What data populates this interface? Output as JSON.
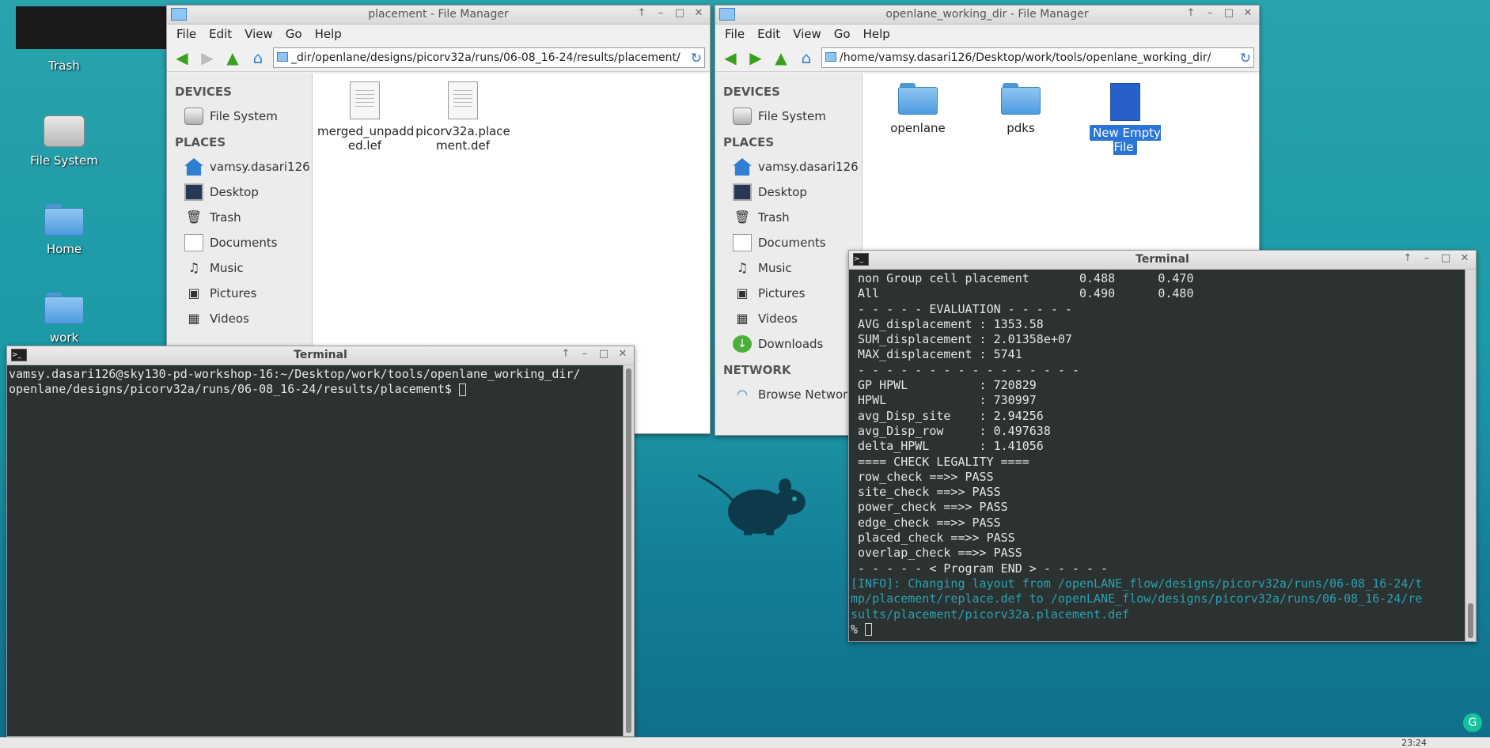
{
  "desktop": {
    "icons": [
      {
        "label": "Trash"
      },
      {
        "label": "File System"
      },
      {
        "label": "Home"
      },
      {
        "label": "work"
      }
    ]
  },
  "fm1": {
    "title": "placement - File Manager",
    "menu": [
      "File",
      "Edit",
      "View",
      "Go",
      "Help"
    ],
    "address": "_dir/openlane/designs/picorv32a/runs/06-08_16-24/results/placement/",
    "devices_header": "DEVICES",
    "places_header": "PLACES",
    "devices": [
      "File System"
    ],
    "places": [
      "vamsy.dasari126",
      "Desktop",
      "Trash",
      "Documents",
      "Music",
      "Pictures",
      "Videos"
    ],
    "files": [
      {
        "name_line1": "merged_unpadd",
        "name_line2": "ed.lef"
      },
      {
        "name_line1": "picorv32a.place",
        "name_line2": "ment.def"
      }
    ]
  },
  "fm2": {
    "title": "openlane_working_dir - File Manager",
    "menu": [
      "File",
      "Edit",
      "View",
      "Go",
      "Help"
    ],
    "address": "/home/vamsy.dasari126/Desktop/work/tools/openlane_working_dir/",
    "devices_header": "DEVICES",
    "places_header": "PLACES",
    "network_header": "NETWORK",
    "devices": [
      "File System"
    ],
    "places": [
      "vamsy.dasari126",
      "Desktop",
      "Trash",
      "Documents",
      "Music",
      "Pictures",
      "Videos",
      "Downloads"
    ],
    "network": [
      "Browse Network"
    ],
    "files": [
      {
        "name": "openlane"
      },
      {
        "name": "pdks"
      },
      {
        "name": "New Empty File"
      }
    ]
  },
  "term1": {
    "title": "Terminal",
    "lines": [
      "vamsy.dasari126@sky130-pd-workshop-16:~/Desktop/work/tools/openlane_working_dir/",
      "openlane/designs/picorv32a/runs/06-08_16-24/results/placement$ "
    ]
  },
  "term2": {
    "title": "Terminal",
    "lines": [
      " non Group cell placement       0.488      0.470",
      " All                            0.490      0.480",
      " - - - - - EVALUATION - - - - -",
      " AVG_displacement : 1353.58",
      " SUM_displacement : 2.01358e+07",
      " MAX_displacement : 5741",
      " - - - - - - - - - - - - - - - -",
      " GP HPWL          : 720829",
      " HPWL             : 730997",
      " avg_Disp_site    : 2.94256",
      " avg_Disp_row     : 0.497638",
      " delta_HPWL       : 1.41056",
      " ==== CHECK LEGALITY ====",
      " row_check ==>> PASS",
      " site_check ==>> PASS",
      " power_check ==>> PASS",
      " edge_check ==>> PASS",
      " placed_check ==>> PASS",
      " overlap_check ==>> PASS",
      " - - - - - < Program END > - - - - -"
    ],
    "info_lines": [
      "[INFO]: Changing layout from /openLANE_flow/designs/picorv32a/runs/06-08_16-24/t",
      "mp/placement/replace.def to /openLANE_flow/designs/picorv32a/runs/06-08_16-24/re",
      "sults/placement/picorv32a.placement.def"
    ],
    "prompt": "% "
  },
  "taskbar": {
    "clock": "23:24"
  }
}
